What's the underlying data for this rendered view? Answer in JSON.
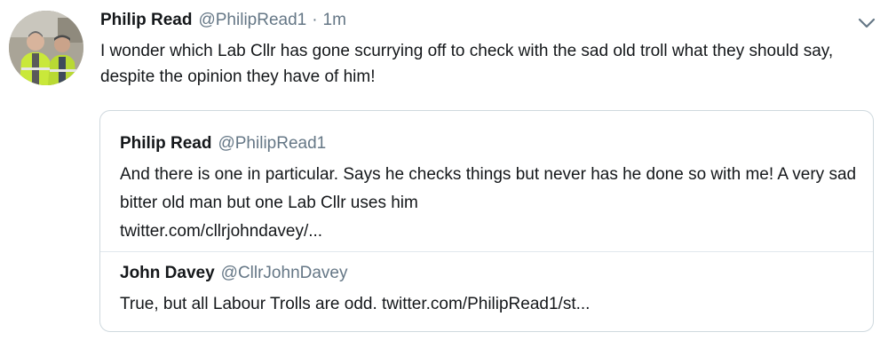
{
  "tweet": {
    "author_name": "Philip Read",
    "author_handle": "@PhilipRead1",
    "separator": "·",
    "timestamp": "1m",
    "text": "I wonder which Lab Cllr has gone scurrying off to check with the sad old troll what they should say, despite the opinion they have of him!",
    "menu_icon": "chevron-down-icon"
  },
  "quoted_tweet": {
    "author_name": "Philip Read",
    "author_handle": "@PhilipRead1",
    "text": "And there is one in particular. Says he checks things but never has he done so with me! A very sad bitter old man but one Lab Cllr uses him",
    "link": "twitter.com/cllrjohndavey/..."
  },
  "nested_quote": {
    "author_name": "John Davey",
    "author_handle": "@CllrJohnDavey",
    "text": "True, but all Labour Trolls are odd. twitter.com/PhilipRead1/st..."
  },
  "colors": {
    "text": "#14171a",
    "secondary": "#657786",
    "border": "#cfd9de"
  }
}
